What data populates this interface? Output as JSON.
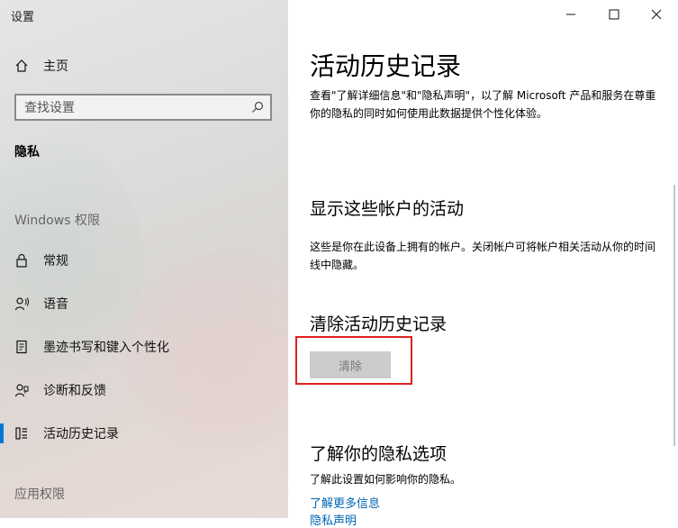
{
  "window": {
    "title": "设置"
  },
  "sidebar": {
    "home": "主页",
    "search_placeholder": "查找设置",
    "category": "隐私",
    "group_windows": "Windows 权限",
    "items": [
      {
        "label": "常规",
        "icon": "lock-icon"
      },
      {
        "label": "语音",
        "icon": "speech-icon"
      },
      {
        "label": "墨迹书写和键入个性化",
        "icon": "inking-icon"
      },
      {
        "label": "诊断和反馈",
        "icon": "diagnostics-icon"
      },
      {
        "label": "活动历史记录",
        "icon": "activity-history-icon",
        "active": true
      }
    ],
    "group_apps": "应用权限",
    "accent": "#0078d7"
  },
  "main": {
    "title": "活动历史记录",
    "intro": "查看\"了解详细信息\"和\"隐私声明\"，以了解 Microsoft 产品和服务在尊重你的隐私的同时如何使用此数据提供个性化体验。",
    "accounts_heading": "显示这些帐户的活动",
    "accounts_desc": "这些是你在此设备上拥有的帐户。关闭帐户可将帐户相关活动从你的时间线中隐藏。",
    "clear_heading": "清除活动历史记录",
    "clear_button": "清除",
    "privacy_heading": "了解你的隐私选项",
    "privacy_desc": "了解此设置如何影响你的隐私。",
    "link_more": "了解更多信息",
    "link_statement": "隐私声明"
  }
}
